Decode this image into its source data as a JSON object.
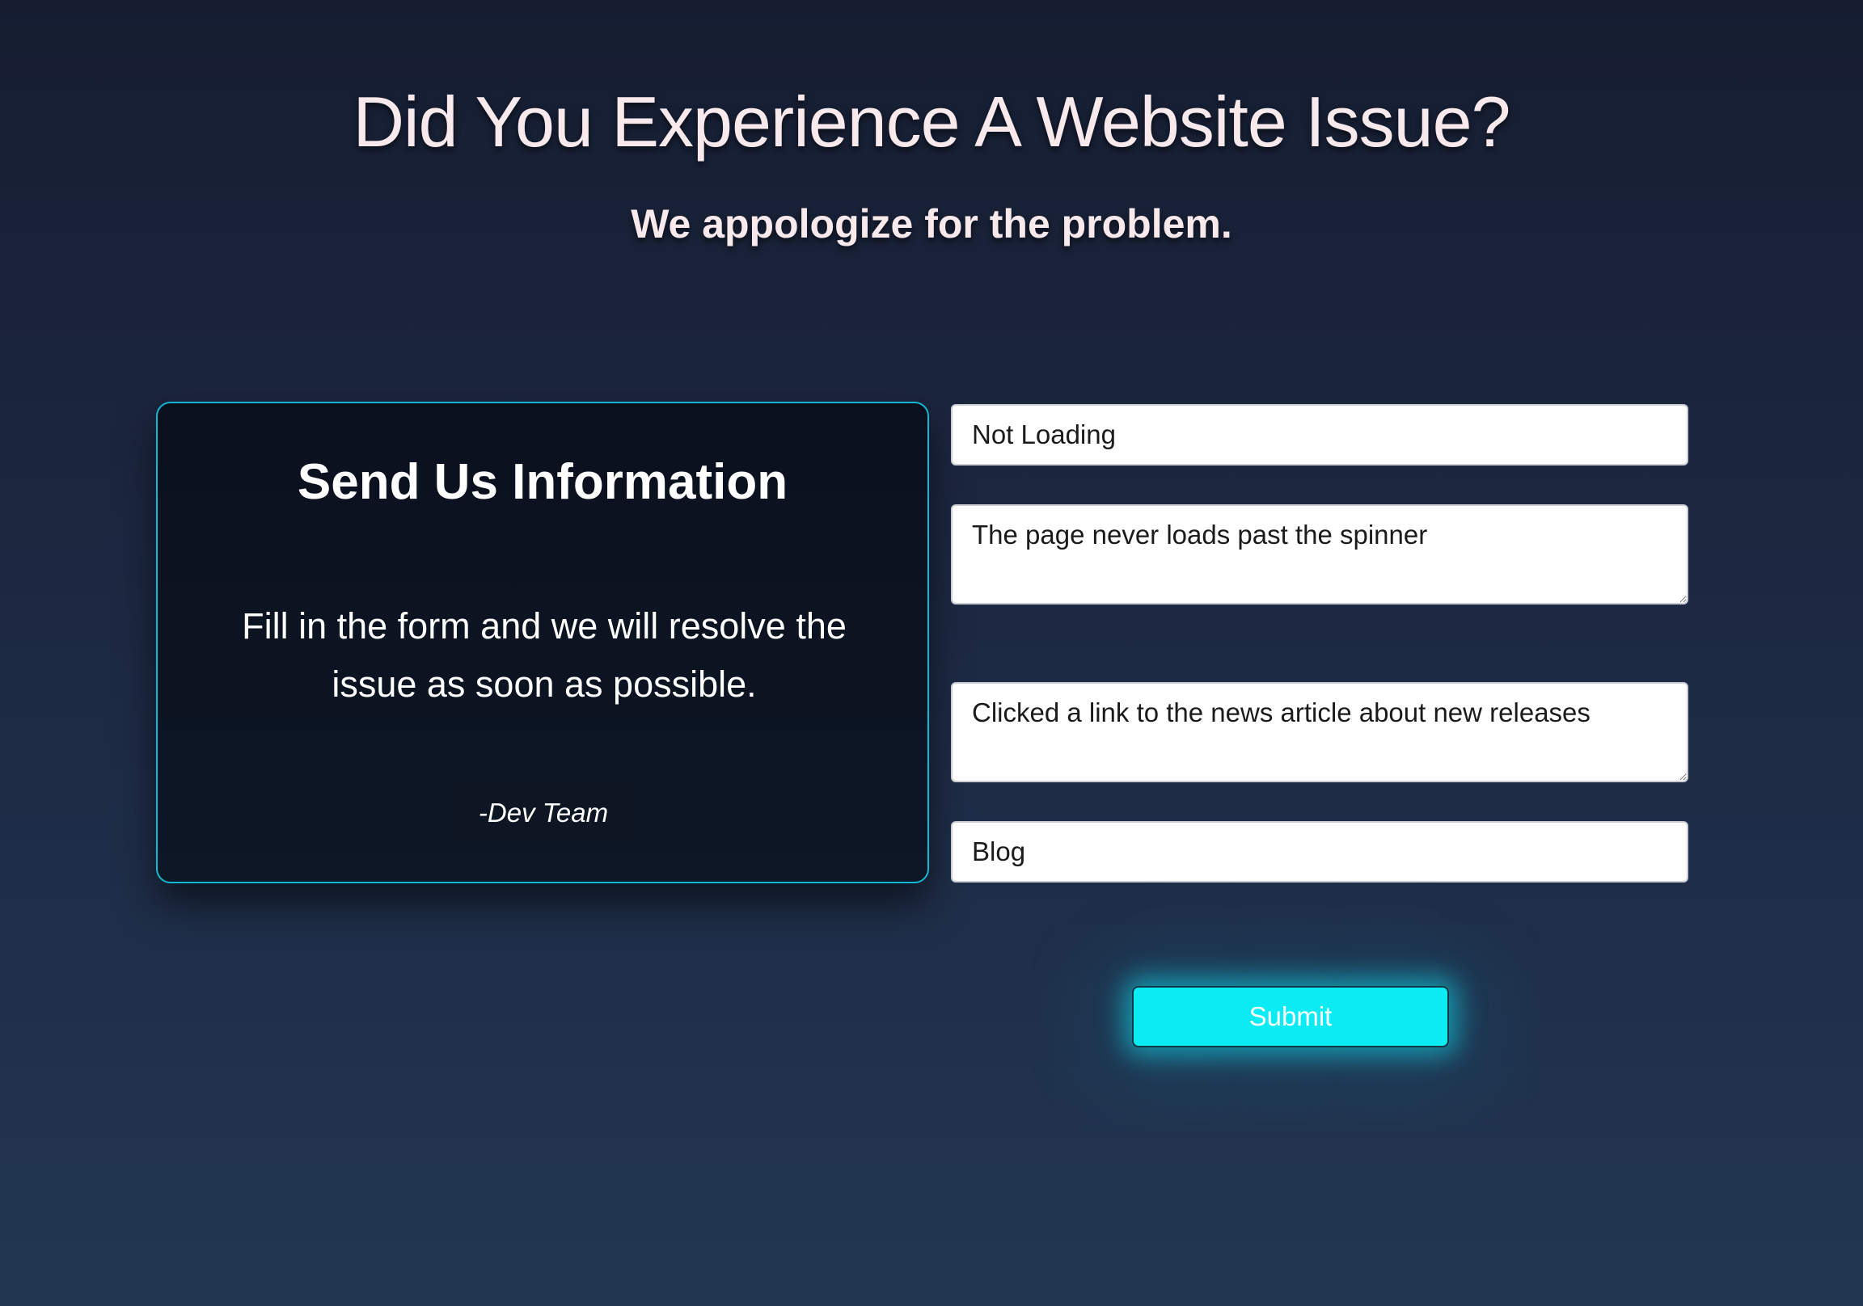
{
  "header": {
    "title": "Did You Experience A Website Issue?",
    "subtitle": "We appologize for the problem."
  },
  "info_card": {
    "title": "Send Us Information",
    "body": "Fill in the form and we will resolve the issue as soon as possible.",
    "signature": "-Dev Team"
  },
  "form": {
    "problem_type": "Not Loading",
    "problem_description": "The page never loads past the spinner",
    "action_description": "Clicked a link to the news article about new releases",
    "page_section": "Blog",
    "submit_label": "Submit"
  },
  "colors": {
    "accent": "#0aebf4",
    "card_border": "#14b8d4",
    "heading_text": "#f7e9ec"
  }
}
